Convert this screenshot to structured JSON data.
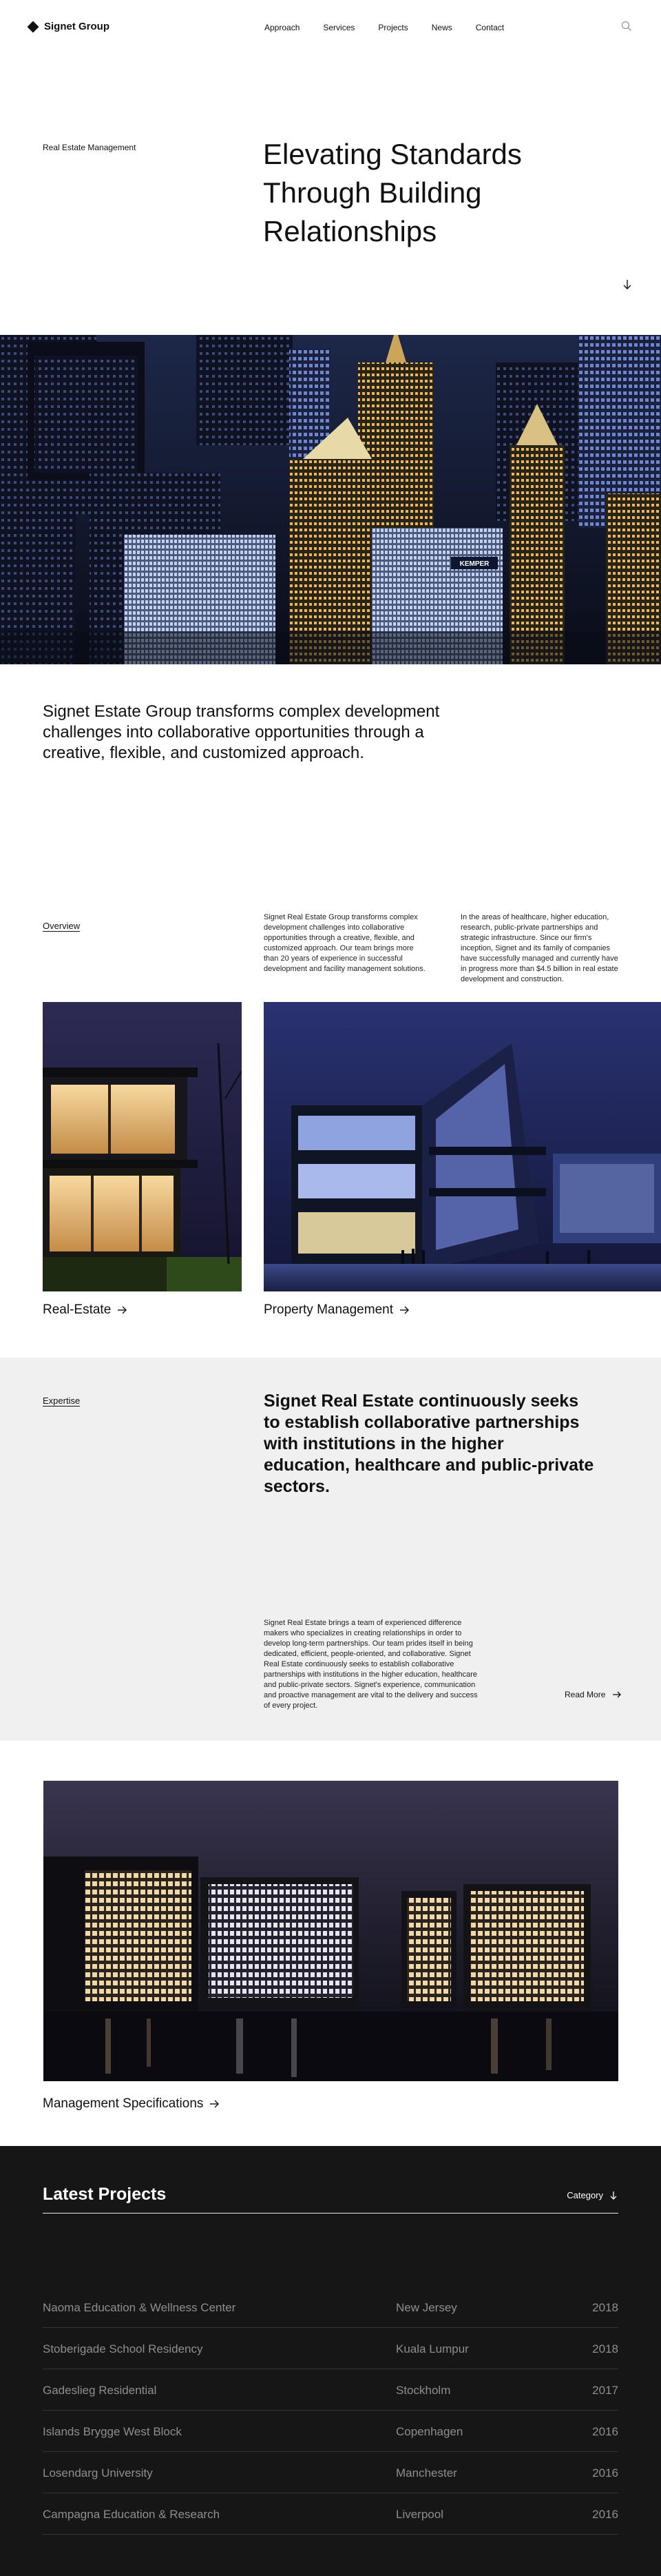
{
  "brand": {
    "name": "Signet Group"
  },
  "nav": {
    "items": [
      "Approach",
      "Services",
      "Projects",
      "News",
      "Contact"
    ]
  },
  "hero": {
    "kicker": "Real Estate Management",
    "title": "Elevating Standards Through Building Relationships"
  },
  "city_image": {
    "sign": "KEMPER"
  },
  "intro": {
    "text": "Signet Estate Group transforms complex development challenges into collaborative opportunities through a creative, flexible, and customized approach."
  },
  "overview": {
    "label": "Overview",
    "col1": "Signet Real Estate Group transforms complex development challenges into collaborative opportunities through a creative, flexible, and customized approach. Our team brings more than 20 years of experience in successful development and facility management solutions.",
    "col2": "In the areas of healthcare, higher education, research, public-private partnerships and strategic infrastructure. Since our firm's inception, Signet and its family of companies have successfully managed and currently have in progress more than $4.5 billion in real estate development and construction."
  },
  "cards": [
    {
      "label": "Real-Estate"
    },
    {
      "label": "Property Management"
    }
  ],
  "expertise": {
    "label": "Expertise",
    "title": "Signet Real Estate continuously seeks to establish collaborative partnerships with institutions in the higher education, healthcare and public-private sectors.",
    "body": "Signet Real Estate brings a team of experienced difference makers who specializes in creating relationships in order to develop long-term partnerships. Our team prides itself in being dedicated, efficient, people-oriented, and collaborative. Signet Real Estate continuously seeks to establish collaborative partnerships with institutions in the higher education, healthcare and public-private sectors. Signet's experience, communication and proactive management are vital to the delivery and success of every project.",
    "read_more": "Read More"
  },
  "spec": {
    "label": "Management Specifications"
  },
  "projects": {
    "title": "Latest Projects",
    "category_label": "Category",
    "rows": [
      {
        "name": "Naoma Education & Wellness Center",
        "city": "New Jersey",
        "year": "2018"
      },
      {
        "name": "Stoberigade School Residency",
        "city": "Kuala Lumpur",
        "year": "2018"
      },
      {
        "name": "Gadeslieg Residential",
        "city": "Stockholm",
        "year": "2017"
      },
      {
        "name": "Islands Brygge West Block",
        "city": "Copenhagen",
        "year": "2016"
      },
      {
        "name": "Losendarg University",
        "city": "Manchester",
        "year": "2016"
      },
      {
        "name": "Campagna Education & Research",
        "city": "Liverpool",
        "year": "2016"
      }
    ]
  },
  "colors": {
    "text": "#111111",
    "expertise_bg": "#f0f0f0",
    "projects_bg": "#161616",
    "projects_muted": "#8e8e8e"
  },
  "icons": [
    "diamond-logo-icon",
    "search-icon",
    "arrow-down-icon",
    "arrow-right-icon",
    "chevron-down-icon"
  ]
}
